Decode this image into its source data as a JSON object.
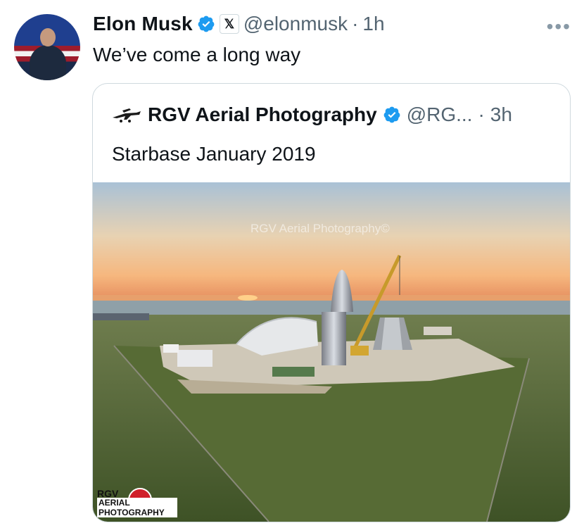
{
  "tweet": {
    "author_name": "Elon Musk",
    "handle": "@elonmusk",
    "separator": "·",
    "time": "1h",
    "text": "We’ve come a long way",
    "more_icon": "more-icon",
    "x_badge_text": "𝕏"
  },
  "quote": {
    "author_name": "RGV Aerial Photography",
    "handle": "@RG...",
    "separator": "·",
    "time": "3h",
    "text": "Starbase January 2019",
    "photo_watermark": "RGV Aerial Photography©",
    "logo_line1": "RGV",
    "logo_line2": "AERIAL PHOTOGRAPHY"
  },
  "colors": {
    "verified_blue": "#1d9bf0",
    "text": "#0f1419",
    "secondary": "#536471",
    "border": "#cfd9de"
  }
}
